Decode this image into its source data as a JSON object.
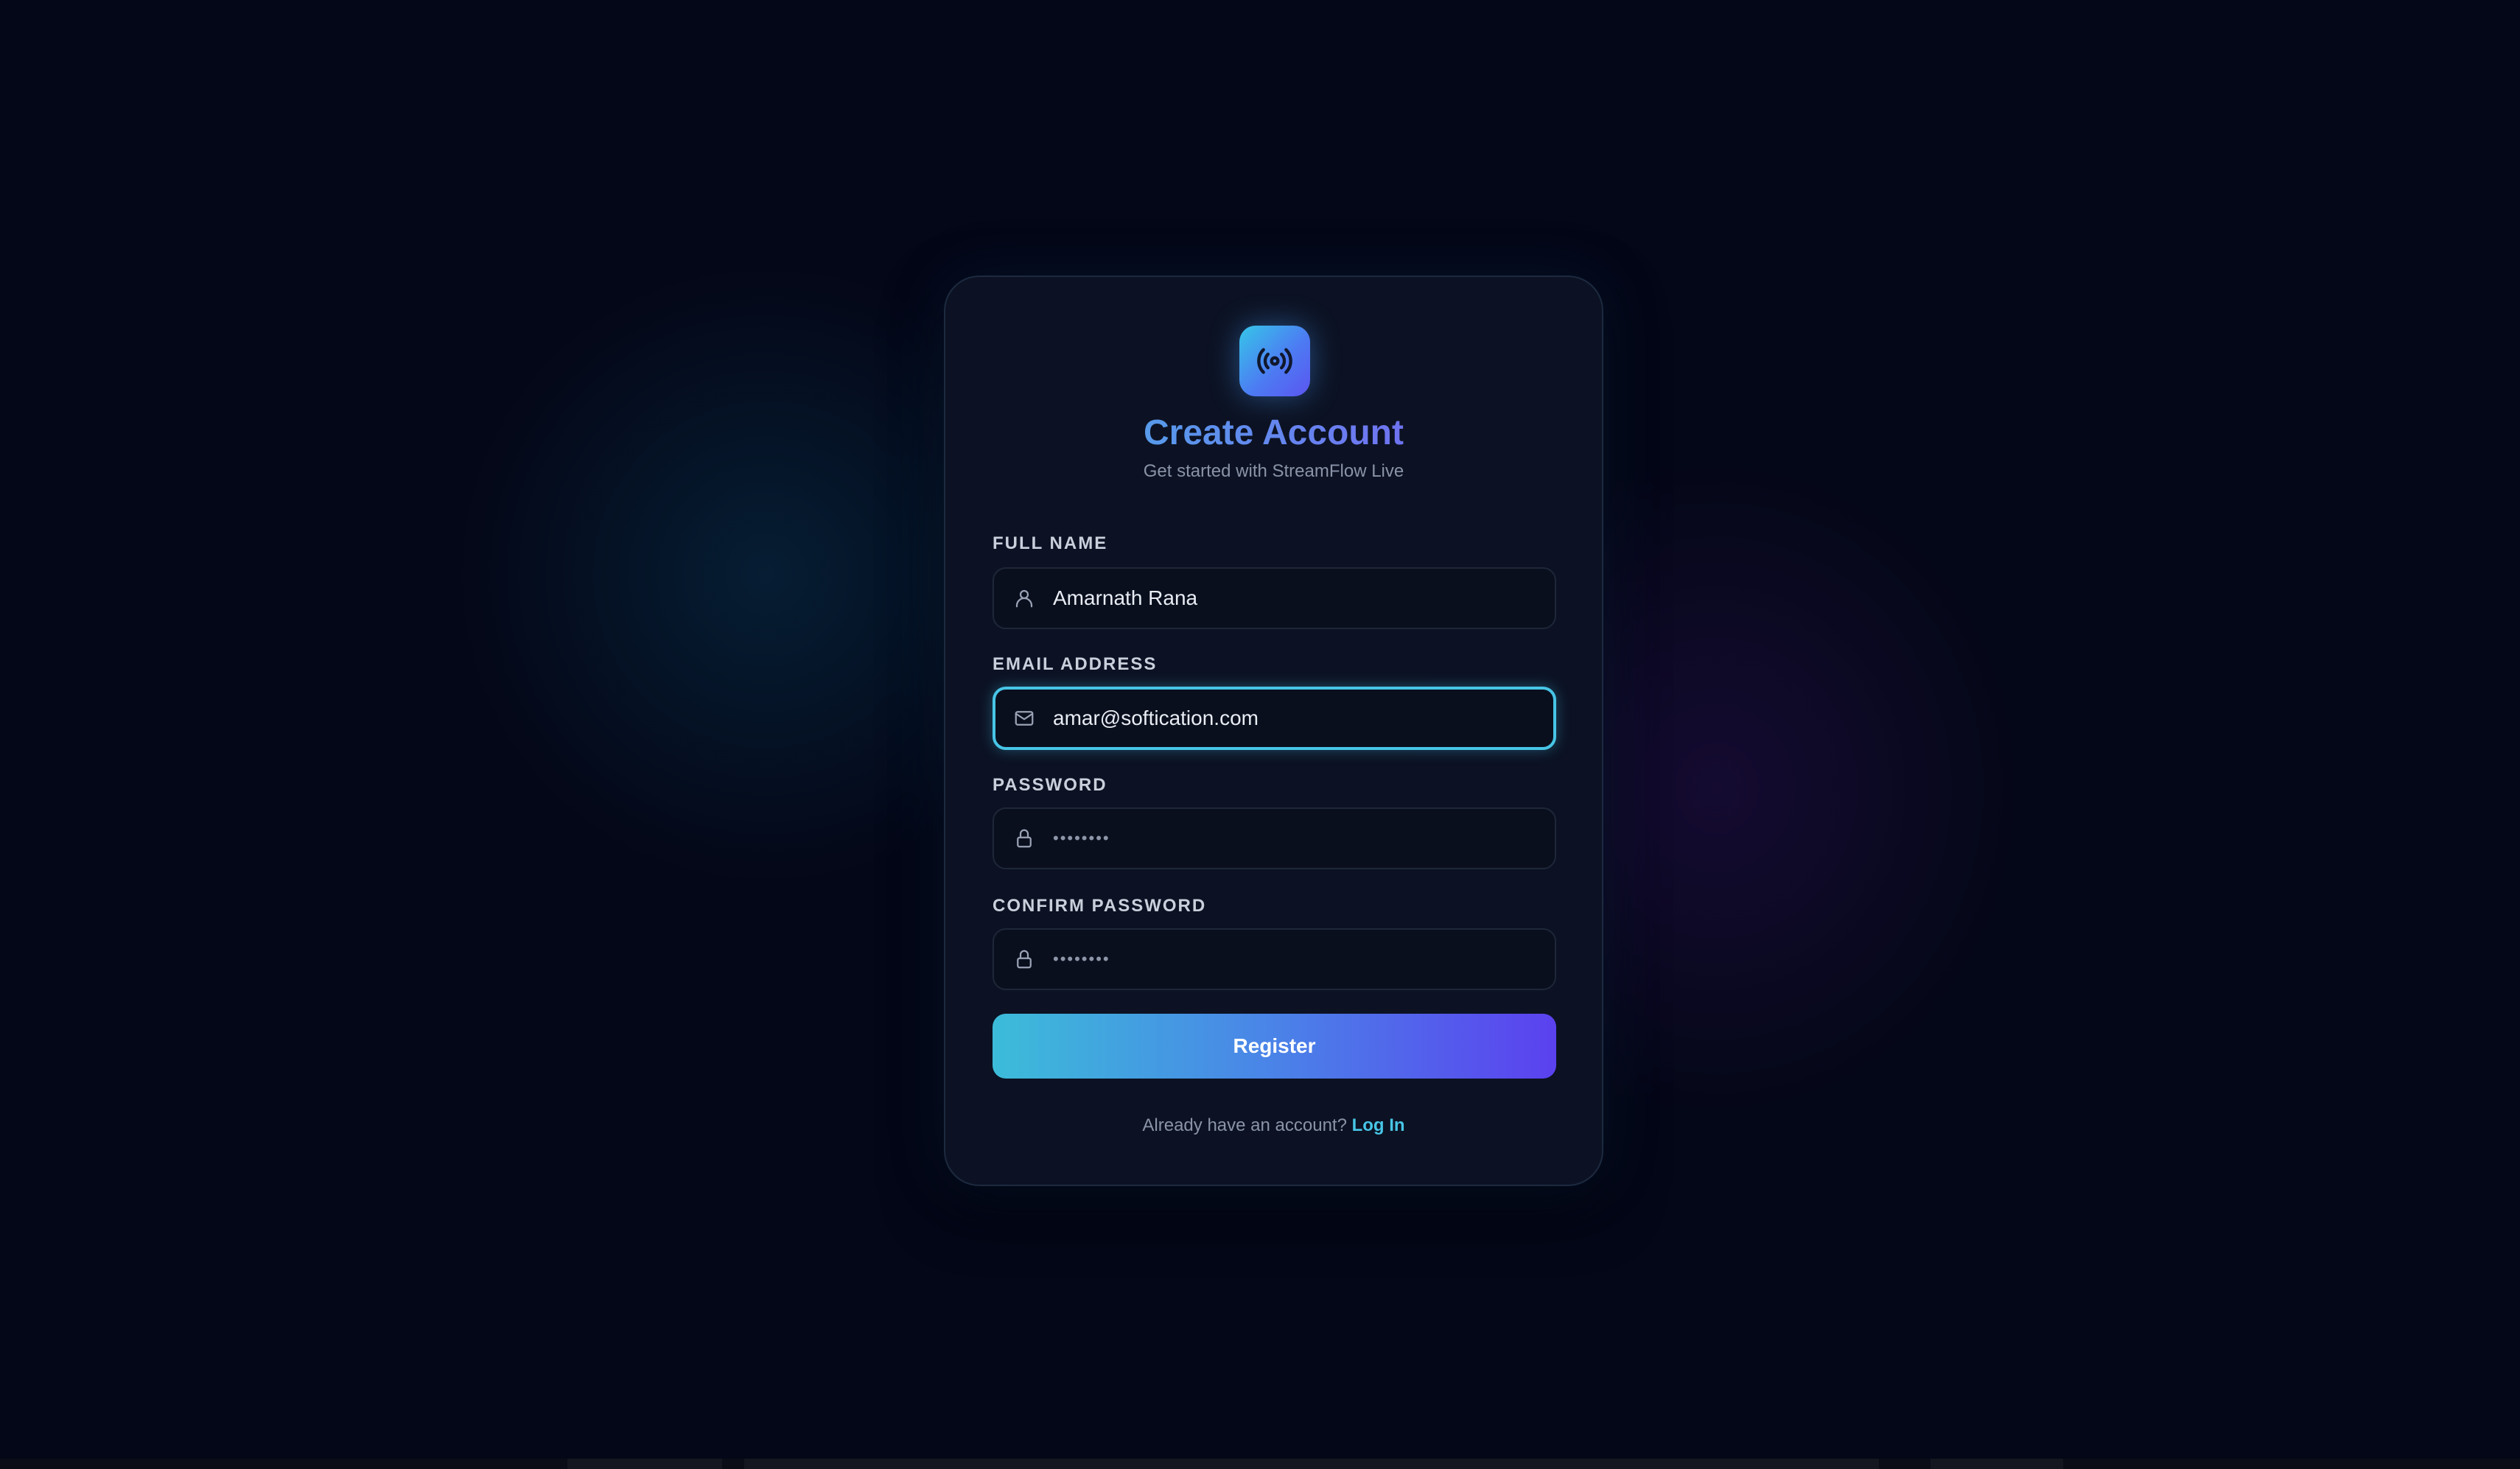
{
  "app": {
    "brand": "StreamFlow Live",
    "logo_icon": "broadcast-icon"
  },
  "form": {
    "title": "Create Account",
    "subtitle": "Get started with StreamFlow Live",
    "fields": {
      "full_name": {
        "label": "FULL NAME",
        "value": "Amarnath Rana",
        "icon": "user-icon"
      },
      "email": {
        "label": "EMAIL ADDRESS",
        "value": "amar@softication.com",
        "icon": "mail-icon",
        "focused": true
      },
      "password": {
        "label": "PASSWORD",
        "masked_value": "••••••••",
        "icon": "lock-icon"
      },
      "confirm_password": {
        "label": "CONFIRM PASSWORD",
        "masked_value": "••••••••",
        "icon": "lock-icon"
      }
    },
    "submit_label": "Register",
    "footer": {
      "prompt": "Already have an account?",
      "link_label": "Log In"
    }
  },
  "colors": {
    "background": "#040717",
    "card": "#0d1324",
    "accent_cyan": "#47c5e6",
    "accent_violet": "#5b41ef"
  }
}
